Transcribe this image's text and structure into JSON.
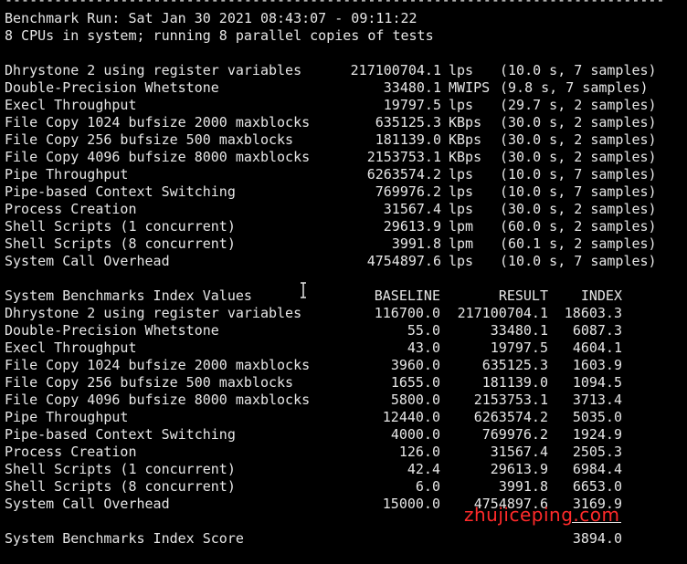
{
  "terminal": {
    "rule": "--------------------------------------------------------------------------------",
    "header": {
      "run_line": "Benchmark Run: Sat Jan 30 2021 08:43:07 - 09:11:22",
      "cpu_line": "8 CPUs in system; running 8 parallel copies of tests"
    },
    "results": [
      {
        "name": "Dhrystone 2 using register variables",
        "value": "217100704.1",
        "unit": "lps",
        "detail": "(10.0 s, 7 samples)"
      },
      {
        "name": "Double-Precision Whetstone",
        "value": "33480.1",
        "unit": "MWIPS",
        "detail": "(9.8 s, 7 samples)"
      },
      {
        "name": "Execl Throughput",
        "value": "19797.5",
        "unit": "lps",
        "detail": "(29.7 s, 2 samples)"
      },
      {
        "name": "File Copy 1024 bufsize 2000 maxblocks",
        "value": "635125.3",
        "unit": "KBps",
        "detail": "(30.0 s, 2 samples)"
      },
      {
        "name": "File Copy 256 bufsize 500 maxblocks",
        "value": "181139.0",
        "unit": "KBps",
        "detail": "(30.0 s, 2 samples)"
      },
      {
        "name": "File Copy 4096 bufsize 8000 maxblocks",
        "value": "2153753.1",
        "unit": "KBps",
        "detail": "(30.0 s, 2 samples)"
      },
      {
        "name": "Pipe Throughput",
        "value": "6263574.2",
        "unit": "lps",
        "detail": "(10.0 s, 7 samples)"
      },
      {
        "name": "Pipe-based Context Switching",
        "value": "769976.2",
        "unit": "lps",
        "detail": "(10.0 s, 7 samples)"
      },
      {
        "name": "Process Creation",
        "value": "31567.4",
        "unit": "lps",
        "detail": "(30.0 s, 2 samples)"
      },
      {
        "name": "Shell Scripts (1 concurrent)",
        "value": "29613.9",
        "unit": "lpm",
        "detail": "(60.0 s, 2 samples)"
      },
      {
        "name": "Shell Scripts (8 concurrent)",
        "value": "3991.8",
        "unit": "lpm",
        "detail": "(60.1 s, 2 samples)"
      },
      {
        "name": "System Call Overhead",
        "value": "4754897.6",
        "unit": "lps",
        "detail": "(10.0 s, 7 samples)"
      }
    ],
    "index_header": {
      "title": "System Benchmarks Index Values",
      "baseline": "BASELINE",
      "result": "RESULT",
      "index": "INDEX"
    },
    "index_rows": [
      {
        "name": "Dhrystone 2 using register variables",
        "baseline": "116700.0",
        "result": "217100704.1",
        "index": "18603.3"
      },
      {
        "name": "Double-Precision Whetstone",
        "baseline": "55.0",
        "result": "33480.1",
        "index": "6087.3"
      },
      {
        "name": "Execl Throughput",
        "baseline": "43.0",
        "result": "19797.5",
        "index": "4604.1"
      },
      {
        "name": "File Copy 1024 bufsize 2000 maxblocks",
        "baseline": "3960.0",
        "result": "635125.3",
        "index": "1603.9"
      },
      {
        "name": "File Copy 256 bufsize 500 maxblocks",
        "baseline": "1655.0",
        "result": "181139.0",
        "index": "1094.5"
      },
      {
        "name": "File Copy 4096 bufsize 8000 maxblocks",
        "baseline": "5800.0",
        "result": "2153753.1",
        "index": "3713.4"
      },
      {
        "name": "Pipe Throughput",
        "baseline": "12440.0",
        "result": "6263574.2",
        "index": "5035.0"
      },
      {
        "name": "Pipe-based Context Switching",
        "baseline": "4000.0",
        "result": "769976.2",
        "index": "1924.9"
      },
      {
        "name": "Process Creation",
        "baseline": "126.0",
        "result": "31567.4",
        "index": "2505.3"
      },
      {
        "name": "Shell Scripts (1 concurrent)",
        "baseline": "42.4",
        "result": "29613.9",
        "index": "6984.4"
      },
      {
        "name": "Shell Scripts (8 concurrent)",
        "baseline": "6.0",
        "result": "3991.8",
        "index": "6653.0"
      },
      {
        "name": "System Call Overhead",
        "baseline": "15000.0",
        "result": "4754897.6",
        "index": "3169.9"
      }
    ],
    "score": {
      "label": "System Benchmarks Index Score",
      "value": "3894.0"
    },
    "watermark": "zhujiceping.com",
    "colors": {
      "background": "#000000",
      "text": "#e6e6e6",
      "watermark": "#ff2a2a"
    },
    "cursor_icon": "text-cursor-icon"
  }
}
